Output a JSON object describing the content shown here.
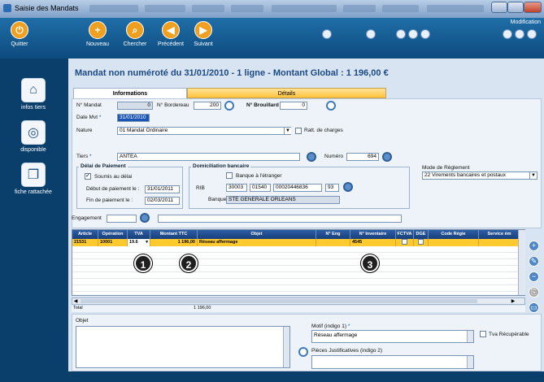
{
  "window": {
    "title": "Saisie des Mandats",
    "mode": "Modification"
  },
  "toolbar": {
    "quit": "Quitter",
    "new": "Nouveau",
    "search": "Chercher",
    "prev": "Précédent",
    "next": "Suivant"
  },
  "left": {
    "infos_tiers": "infos tiers",
    "disponible": "disponible",
    "fiche": "fiche rattachée"
  },
  "header": "Mandat non numéroté du 31/01/2010 - 1 ligne - Montant Global :  1 196,00 €",
  "tabs": {
    "info": "Informations",
    "details": "Détails"
  },
  "form": {
    "mandat_label": "N° Mandat",
    "mandat_value": "0",
    "bordereau_label": "N° Bordereau",
    "bordereau_value": "200",
    "brouillard_label": "N° Brouillard",
    "brouillard_value": "0",
    "date_label": "Date Mvt",
    "date_value": "31/01/2010",
    "nature_label": "Nature",
    "nature_value": "01 Mandat Ordinaire",
    "ratt_label": "Ratt. de charges",
    "tiers_label": "Tiers",
    "tiers_value": "ANTEA",
    "numero_label": "Numéro",
    "numero_value": "694",
    "delai_title": "Délai de Paiement",
    "soumis_label": "Soumis au délai",
    "debut_label": "Début de paiement le :",
    "debut_value": "31/01/2011",
    "fin_label": "Fin de paiement le :",
    "fin_value": "02/03/2011",
    "domic_title": "Domiciliation bancaire",
    "banque_etranger": "Banque à l'étranger",
    "rib_label": "RIB",
    "rib_1": "30003",
    "rib_2": "01540",
    "rib_3": "00020446836",
    "rib_4": "93",
    "banque_label": "Banque",
    "banque_value": "STE GENERALE ORLEANS",
    "mode_label": "Mode de Règlement",
    "mode_value": "22 Virements bancaires et postaux",
    "engagement_label": "Engagement"
  },
  "grid": {
    "columns": [
      "Article",
      "Opération",
      "TVA",
      "Montant TTC",
      "Objet",
      "N° Eng",
      "N° Inventaire",
      "FCTVA",
      "DGE",
      "Code Régie",
      "Service ém"
    ],
    "row": {
      "article": "21531",
      "operation": "10001",
      "tva": "19.6",
      "montant": "1 196,00",
      "objet": "Réseau affermage",
      "eng": "",
      "inventaire": "4545"
    },
    "total_label": "Total",
    "total_value": "1 196,00"
  },
  "badges": [
    "1",
    "2",
    "3"
  ],
  "bottom": {
    "objet_label": "Objet",
    "motif_label": "Motif (indigo 1)",
    "motif_value": "Réseau affermage",
    "pieces_label": "Pièces Justificatives (indigo 2)",
    "tva_recup": "Tva Récupérable"
  }
}
